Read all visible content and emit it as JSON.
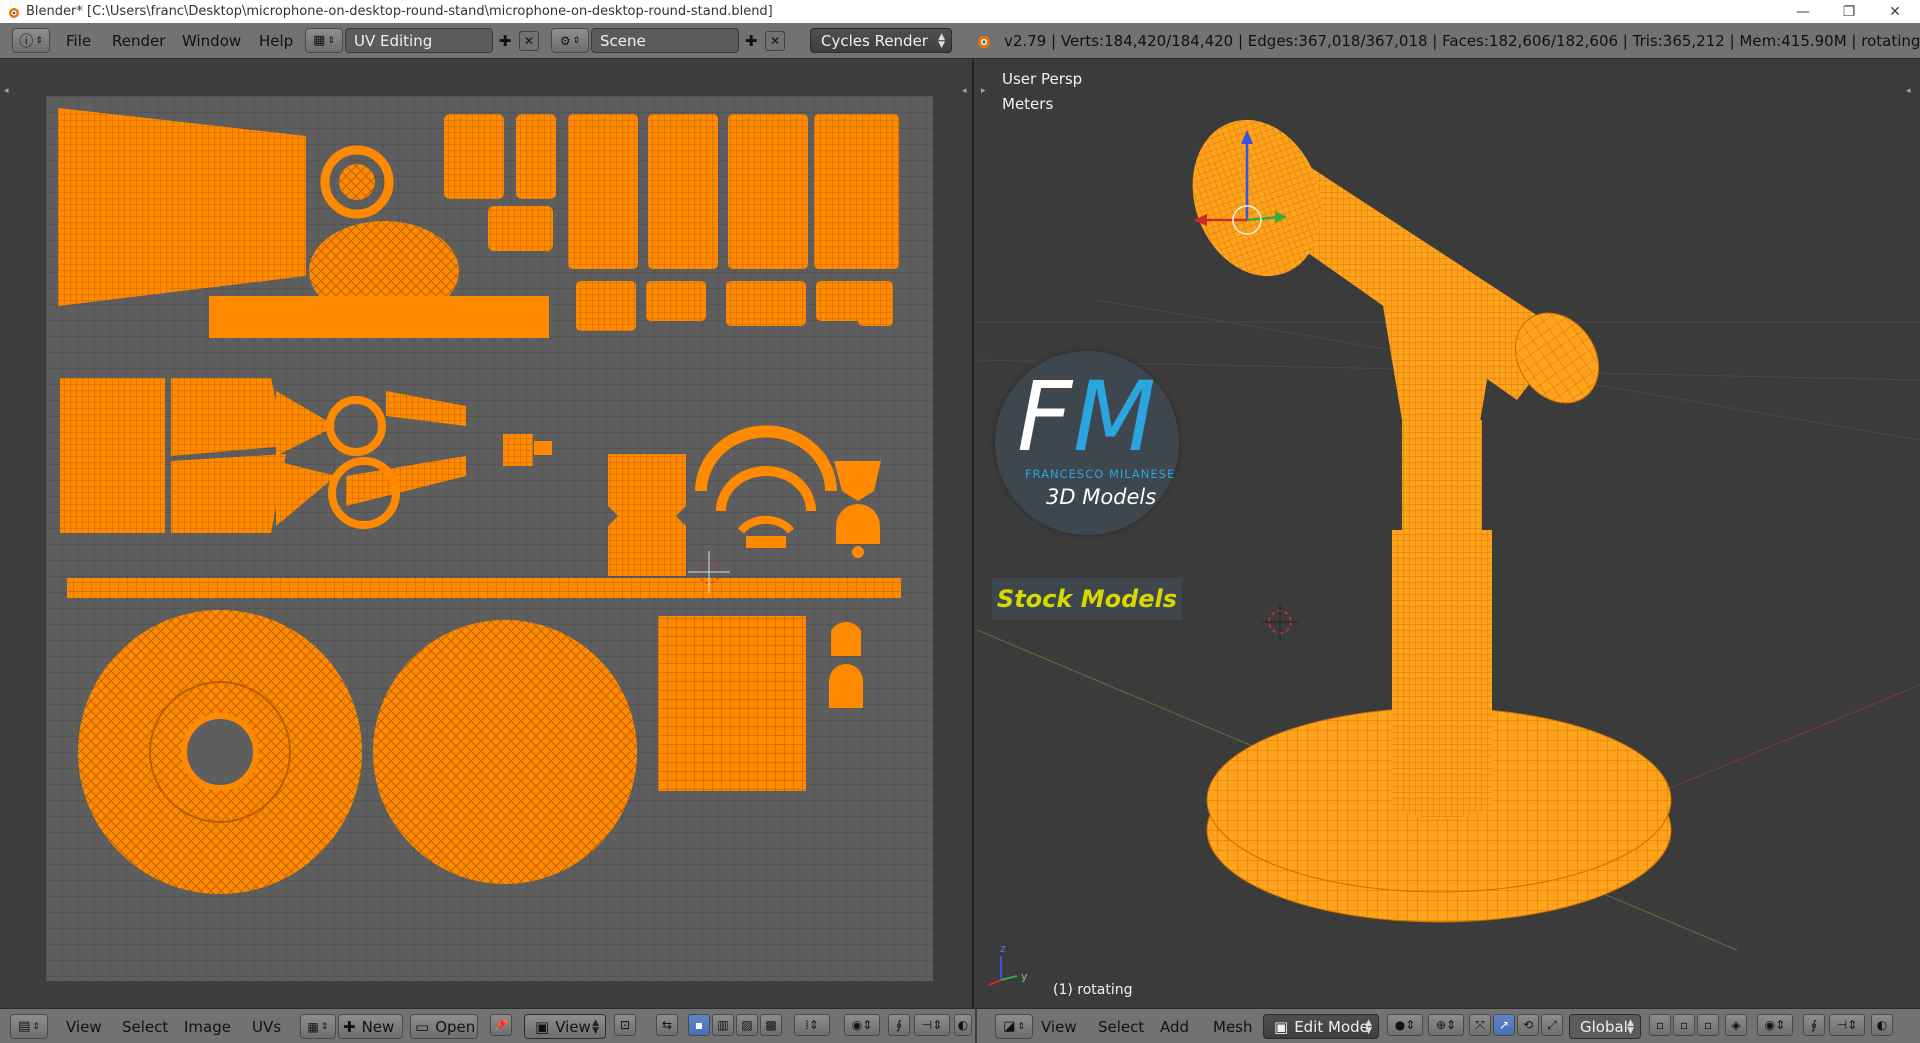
{
  "window": {
    "title": "Blender* [C:\\Users\\franc\\Desktop\\microphone-on-desktop-round-stand\\microphone-on-desktop-round-stand.blend]",
    "minimize": "—",
    "maximize": "❐",
    "close": "✕"
  },
  "top_header": {
    "menus": [
      "File",
      "Render",
      "Window",
      "Help"
    ],
    "screen_layout": "UV Editing",
    "scene": "Scene",
    "render_engine": "Cycles Render",
    "stats": "v2.79 | Verts:184,420/184,420 | Edges:367,018/367,018 | Faces:182,606/182,606 | Tris:365,212 | Mem:415.90M | rotating"
  },
  "uv_editor": {
    "header_menus": [
      "View",
      "Select",
      "Image",
      "UVs"
    ],
    "new_label": "New",
    "open_label": "Open",
    "view_dropdown": "View"
  },
  "viewport": {
    "view_name": "User Persp",
    "units": "Meters",
    "object_info": "(1) rotating",
    "header_menus": [
      "View",
      "Select",
      "Add",
      "Mesh"
    ],
    "mode": "Edit Mode",
    "orientation": "Global",
    "axis_labels": {
      "x": "x",
      "y": "y",
      "z": "z"
    }
  },
  "watermark": {
    "logo_letters_f": "F",
    "logo_letters_m": "M",
    "brand_name": "FRANCESCO MILANESE",
    "tagline": "3D Models",
    "banner": "Stock Models"
  },
  "colors": {
    "mesh_orange": "#ff8c00",
    "uv_orange": "#ff8a00",
    "header_gray": "#727272",
    "editor_bg": "#3d3d3d",
    "logo_blue": "#2aa5dd",
    "banner_yellow": "#d8d800"
  }
}
